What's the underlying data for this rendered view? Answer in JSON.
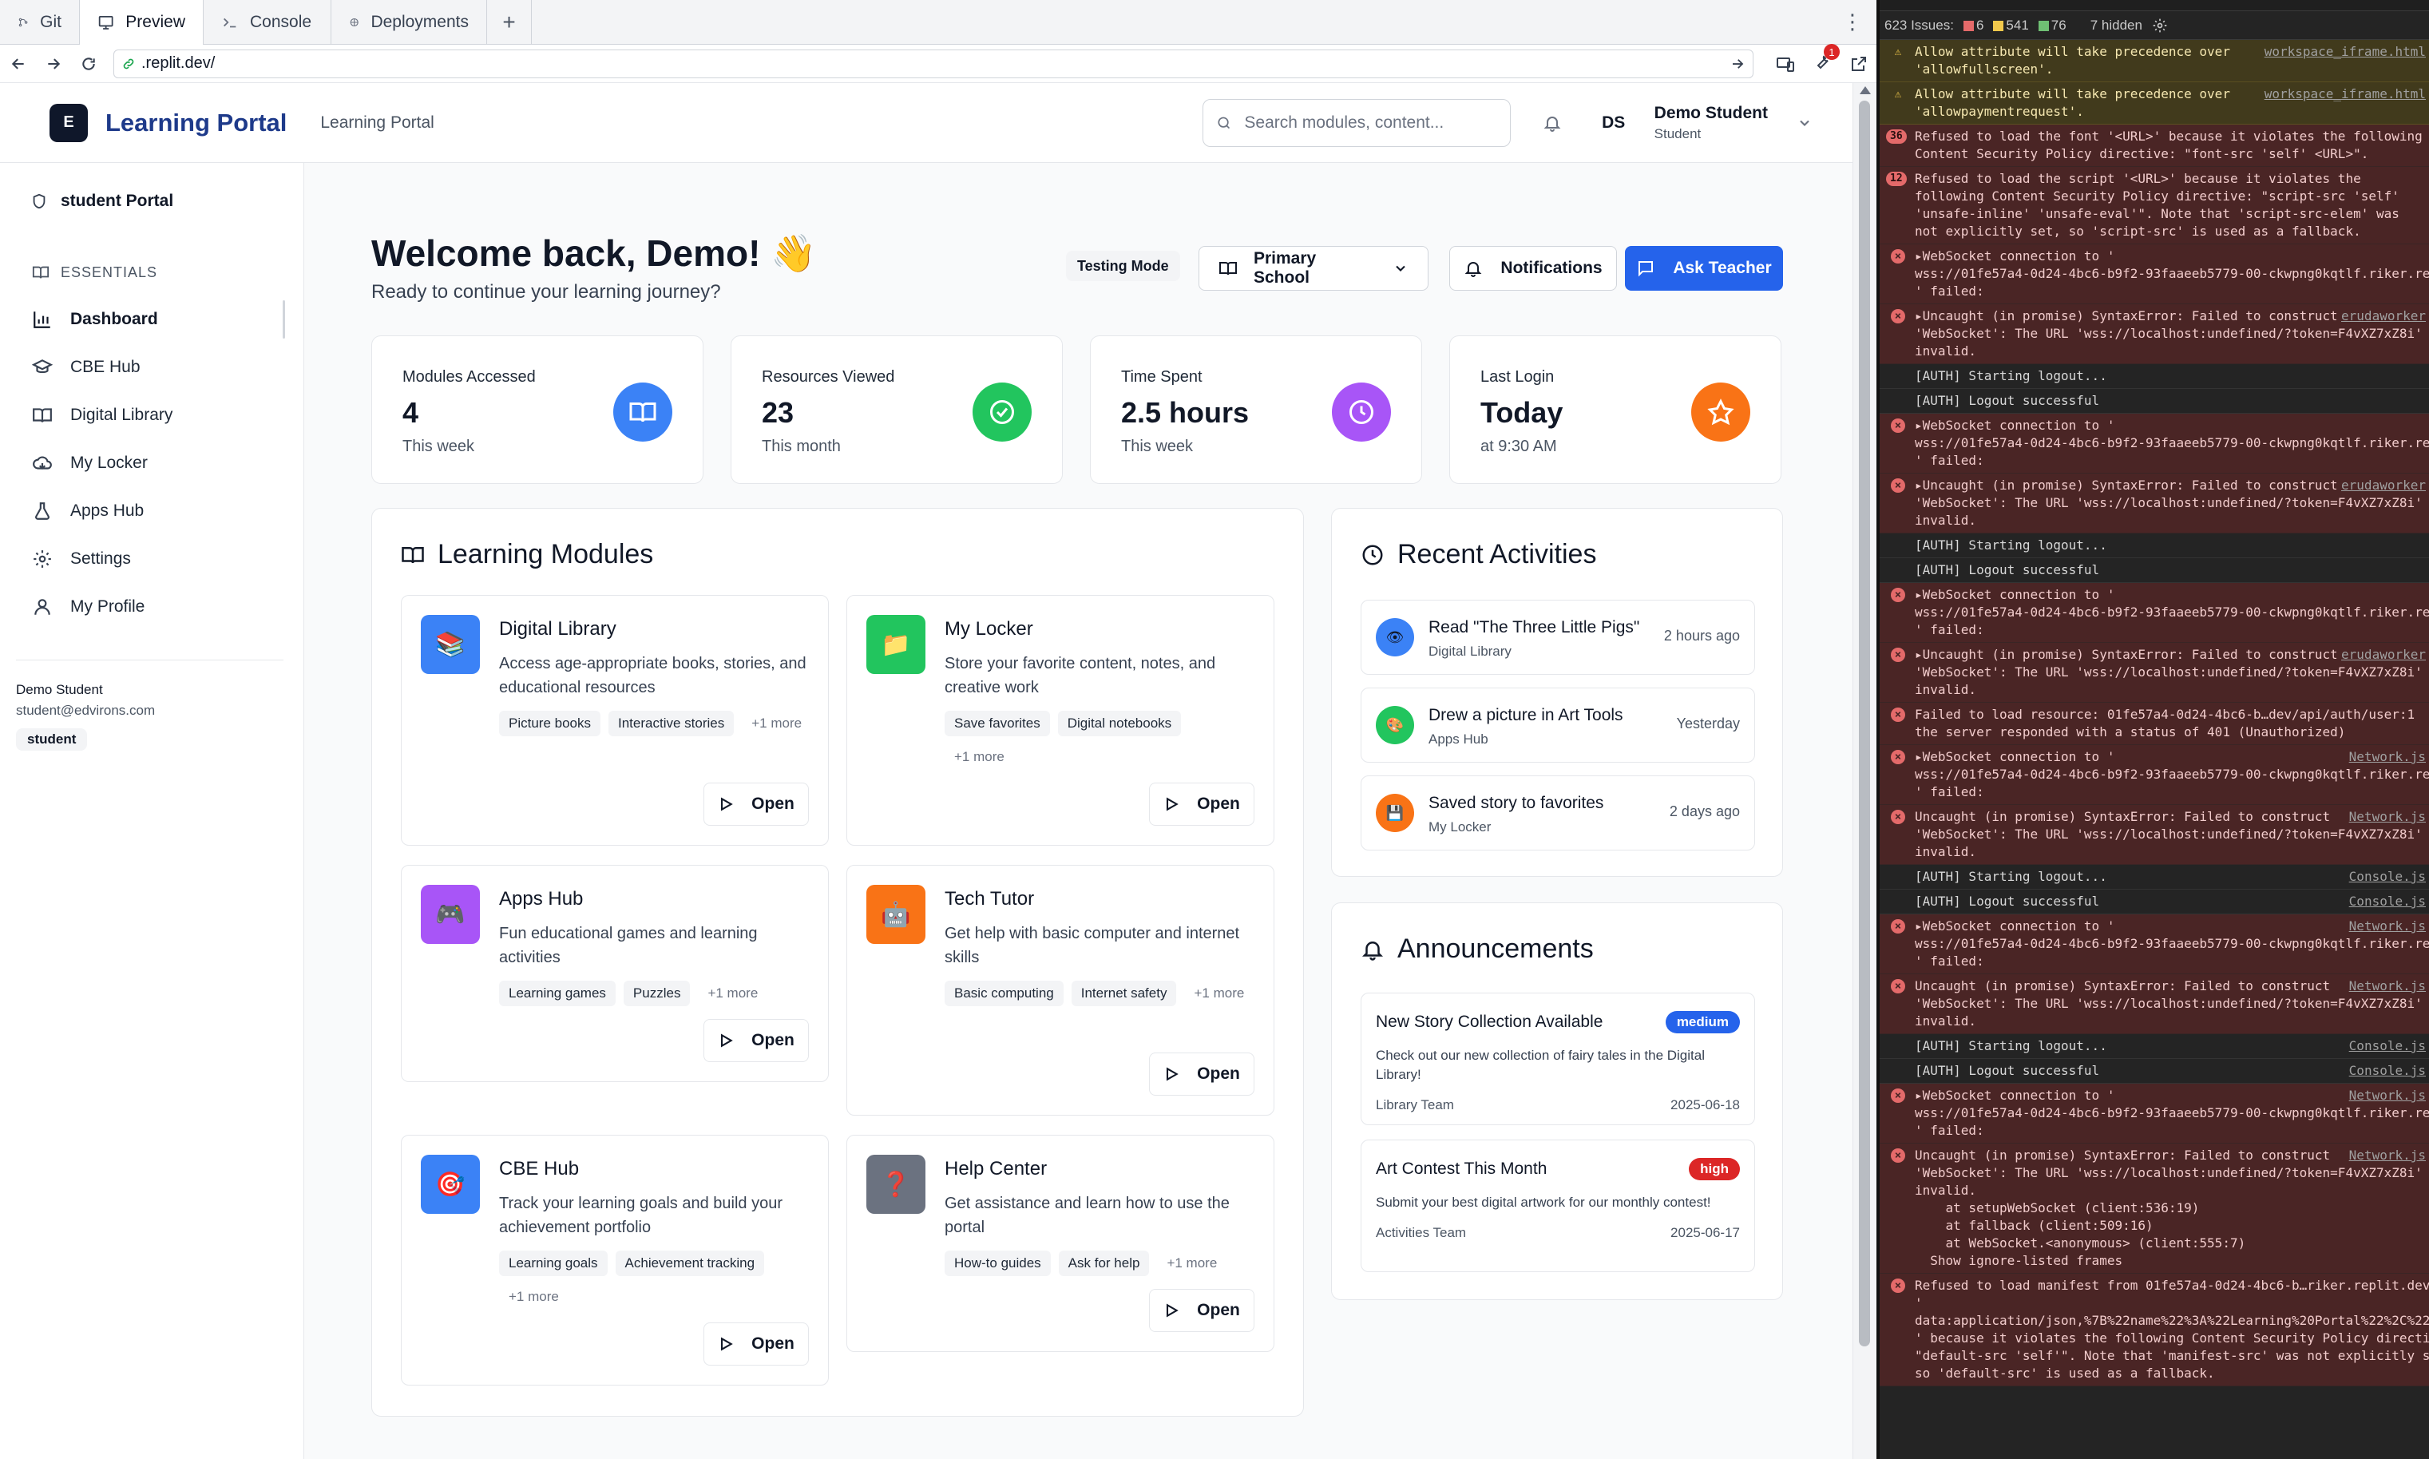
{
  "browser": {
    "tabs": [
      "Git",
      "Preview",
      "Console",
      "Deployments"
    ],
    "url": ".replit.dev/",
    "notif_count": "1"
  },
  "header": {
    "logo_letter": "E",
    "brand": "Learning Portal",
    "subtitle": "Learning Portal",
    "search_placeholder": "Search modules, content...",
    "avatar_initials": "DS",
    "user_name": "Demo Student",
    "user_role": "Student"
  },
  "sidebar": {
    "portal_label": "student Portal",
    "section_label": "ESSENTIALS",
    "items": [
      {
        "label": "Dashboard",
        "icon": "bar-chart-icon"
      },
      {
        "label": "CBE Hub",
        "icon": "graduation-cap-icon"
      },
      {
        "label": "Digital Library",
        "icon": "book-open-icon"
      },
      {
        "label": "My Locker",
        "icon": "cloud-icon"
      },
      {
        "label": "Apps Hub",
        "icon": "flask-icon"
      },
      {
        "label": "Settings",
        "icon": "gear-icon"
      },
      {
        "label": "My Profile",
        "icon": "user-icon"
      }
    ],
    "user_name": "Demo Student",
    "user_email": "student@edvirons.com",
    "user_badge": "student"
  },
  "main": {
    "welcome_title": "Welcome back, Demo!",
    "welcome_emoji": "👋",
    "welcome_sub": "Ready to continue your learning journey?",
    "testing_mode": "Testing Mode",
    "school_select": "Primary School",
    "notifications_btn": "Notifications",
    "ask_teacher_btn": "Ask Teacher",
    "stats": [
      {
        "label": "Modules Accessed",
        "value": "4",
        "note": "This week",
        "color": "#3b82f6",
        "icon": "book-icon"
      },
      {
        "label": "Resources Viewed",
        "value": "23",
        "note": "This month",
        "color": "#22c55e",
        "icon": "check-circle-icon"
      },
      {
        "label": "Time Spent",
        "value": "2.5 hours",
        "note": "This week",
        "color": "#a855f7",
        "icon": "clock-icon"
      },
      {
        "label": "Last Login",
        "value": "Today",
        "note": "at 9:30 AM",
        "color": "#f97316",
        "icon": "star-icon"
      }
    ],
    "modules_title": "Learning Modules",
    "modules": [
      {
        "title": "Digital Library",
        "desc": "Access age-appropriate books, stories, and educational resources",
        "tags": [
          "Picture books",
          "Interactive stories"
        ],
        "more": "+1 more",
        "color": "#3b82f6",
        "emoji": "📚",
        "open": "Open"
      },
      {
        "title": "My Locker",
        "desc": "Store your favorite content, notes, and creative work",
        "tags": [
          "Save favorites",
          "Digital notebooks"
        ],
        "more": "+1 more",
        "color": "#22c55e",
        "emoji": "📁",
        "open": "Open"
      },
      {
        "title": "Apps Hub",
        "desc": "Fun educational games and learning activities",
        "tags": [
          "Learning games",
          "Puzzles"
        ],
        "more": "+1 more",
        "color": "#a855f7",
        "emoji": "🎮",
        "open": "Open"
      },
      {
        "title": "Tech Tutor",
        "desc": "Get help with basic computer and internet skills",
        "tags": [
          "Basic computing",
          "Internet safety"
        ],
        "more": "+1 more",
        "color": "#f97316",
        "emoji": "🤖",
        "open": "Open"
      },
      {
        "title": "CBE Hub",
        "desc": "Track your learning goals and build your achievement portfolio",
        "tags": [
          "Learning goals",
          "Achievement tracking"
        ],
        "more": "+1 more",
        "color": "#3b82f6",
        "emoji": "🎯",
        "open": "Open"
      },
      {
        "title": "Help Center",
        "desc": "Get assistance and learn how to use the portal",
        "tags": [
          "How-to guides",
          "Ask for help"
        ],
        "more": "+1 more",
        "color": "#6b7280",
        "emoji": "❓",
        "open": "Open"
      }
    ],
    "activities_title": "Recent Activities",
    "activities": [
      {
        "title": "Read \"The Three Little Pigs\"",
        "sub": "Digital Library",
        "time": "2 hours ago",
        "color": "#3b82f6",
        "emoji": "👁"
      },
      {
        "title": "Drew a picture in Art Tools",
        "sub": "Apps Hub",
        "time": "Yesterday",
        "color": "#22c55e",
        "emoji": "🎨"
      },
      {
        "title": "Saved story to favorites",
        "sub": "My Locker",
        "time": "2 days ago",
        "color": "#f97316",
        "emoji": "💾"
      }
    ],
    "announcements_title": "Announcements",
    "announcements": [
      {
        "title": "New Story Collection Available",
        "priority": "medium",
        "priority_color": "#2563eb",
        "desc": "Check out our new collection of fairy tales in the Digital Library!",
        "author": "Library Team",
        "date": "2025-06-18"
      },
      {
        "title": "Art Contest This Month",
        "priority": "high",
        "priority_color": "#dc2626",
        "desc": "Submit your best digital artwork for our monthly contest!",
        "author": "Activities Team",
        "date": "2025-06-17"
      }
    ]
  },
  "devtools": {
    "issues_label": "623 Issues:",
    "errors": "6",
    "warnings": "541",
    "infos": "76",
    "hidden": "7 hidden",
    "messages": [
      {
        "type": "warning",
        "text": "Allow attribute will take precedence over\n'allowfullscreen'.",
        "src": "workspace_iframe.html"
      },
      {
        "type": "warning",
        "text": "Allow attribute will take precedence over\n'allowpaymentrequest'.",
        "src": "workspace_iframe.html"
      },
      {
        "type": "error",
        "count": "36",
        "text": "Refused to load the font '<URL>' because it violates the following\nContent Security Policy directive: \"font-src 'self' <URL>\".",
        "src": ""
      },
      {
        "type": "error",
        "count": "12",
        "text": "Refused to load the script '<URL>' because it violates the\nfollowing Content Security Policy directive: \"script-src 'self'\n'unsafe-inline' 'unsafe-eval'\". Note that 'script-src-elem' was\nnot explicitly set, so 'script-src' is used as a fallback.",
        "src": ""
      },
      {
        "type": "error",
        "text": "▸WebSocket connection to '\nwss://01fe57a4-0d24-4bc6-b9f2-93faaeeb5779-00-ckwpng0kqtlf.riker.replit.dev\n' failed:",
        "src": ""
      },
      {
        "type": "error",
        "text": "▸Uncaught (in promise) SyntaxError: Failed to construct\n'WebSocket': The URL 'wss://localhost:undefined/?token=F4vXZ7xZ8i'\ninvalid.",
        "src": "erudaworker"
      },
      {
        "type": "log",
        "text": "[AUTH] Starting logout...",
        "src": ""
      },
      {
        "type": "log",
        "text": "[AUTH] Logout successful",
        "src": ""
      },
      {
        "type": "error",
        "text": "▸WebSocket connection to '\nwss://01fe57a4-0d24-4bc6-b9f2-93faaeeb5779-00-ckwpng0kqtlf.riker.replit.dev\n' failed:",
        "src": ""
      },
      {
        "type": "error",
        "text": "▸Uncaught (in promise) SyntaxError: Failed to construct\n'WebSocket': The URL 'wss://localhost:undefined/?token=F4vXZ7xZ8i'\ninvalid.",
        "src": "erudaworker"
      },
      {
        "type": "log",
        "text": "[AUTH] Starting logout...",
        "src": ""
      },
      {
        "type": "log",
        "text": "[AUTH] Logout successful",
        "src": ""
      },
      {
        "type": "error",
        "text": "▸WebSocket connection to '\nwss://01fe57a4-0d24-4bc6-b9f2-93faaeeb5779-00-ckwpng0kqtlf.riker.replit.dev\n' failed:",
        "src": ""
      },
      {
        "type": "error",
        "text": "▸Uncaught (in promise) SyntaxError: Failed to construct\n'WebSocket': The URL 'wss://localhost:undefined/?token=F4vXZ7xZ8i'\ninvalid.",
        "src": "erudaworker"
      },
      {
        "type": "error",
        "text": "Failed to load resource: 01fe57a4-0d24-4bc6-b…dev/api/auth/user:1\nthe server responded with a status of 401 (Unauthorized)",
        "src": ""
      },
      {
        "type": "error",
        "text": "▸WebSocket connection to '\nwss://01fe57a4-0d24-4bc6-b9f2-93faaeeb5779-00-ckwpng0kqtlf.riker.replit.dev\n' failed:",
        "src": "Network.js"
      },
      {
        "type": "error",
        "text": "Uncaught (in promise) SyntaxError: Failed to construct\n'WebSocket': The URL 'wss://localhost:undefined/?token=F4vXZ7xZ8i'\ninvalid.",
        "src": "Network.js"
      },
      {
        "type": "log",
        "text": "[AUTH] Starting logout...",
        "src": "Console.js"
      },
      {
        "type": "log",
        "text": "[AUTH] Logout successful",
        "src": "Console.js"
      },
      {
        "type": "error",
        "text": "▸WebSocket connection to '\nwss://01fe57a4-0d24-4bc6-b9f2-93faaeeb5779-00-ckwpng0kqtlf.riker.replit.dev\n' failed:",
        "src": "Network.js"
      },
      {
        "type": "error",
        "text": "Uncaught (in promise) SyntaxError: Failed to construct\n'WebSocket': The URL 'wss://localhost:undefined/?token=F4vXZ7xZ8i'\ninvalid.",
        "src": "Network.js"
      },
      {
        "type": "log",
        "text": "[AUTH] Starting logout...",
        "src": "Console.js"
      },
      {
        "type": "log",
        "text": "[AUTH] Logout successful",
        "src": "Console.js"
      },
      {
        "type": "error",
        "text": "▸WebSocket connection to '\nwss://01fe57a4-0d24-4bc6-b9f2-93faaeeb5779-00-ckwpng0kqtlf.riker.replit.dev\n' failed:",
        "src": "Network.js"
      },
      {
        "type": "error",
        "text": "Uncaught (in promise) SyntaxError: Failed to construct\n'WebSocket': The URL 'wss://localhost:undefined/?token=F4vXZ7xZ8i'\ninvalid.\n    at setupWebSocket (client:536:19)\n    at fallback (client:509:16)\n    at WebSocket.<anonymous> (client:555:7)\n  Show ignore-listed frames",
        "src": "Network.js"
      },
      {
        "type": "error",
        "text": "Refused to load manifest from 01fe57a4-0d24-4bc6-b…riker.replit.dev/:1\n'\ndata:application/json,%7B%22name%22%3A%22Learning%20Portal%22%2C%22\n' because it violates the following Content Security Policy directive:\n\"default-src 'self'\". Note that 'manifest-src' was not explicitly set,\nso 'default-src' is used as a fallback.",
        "src": ""
      }
    ]
  }
}
